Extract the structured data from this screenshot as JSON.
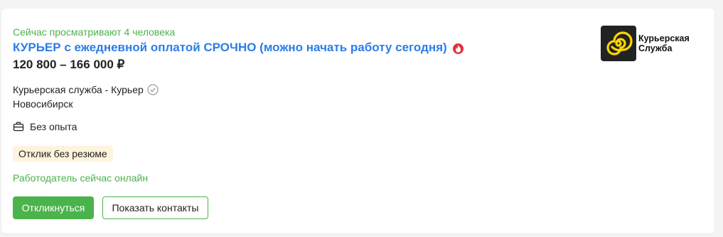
{
  "vacancy": {
    "viewers_text": "Сейчас просматривают 4 человека",
    "title": "КУРЬЕР с ежедневной оплатой СРОЧНО (можно начать работу сегодня)",
    "salary": "120 800 – 166 000 ₽",
    "company": "Курьерская служба - Курьер",
    "city": "Новосибирск",
    "experience": "Без опыта",
    "badge": "Отклик без резюме",
    "employer_status": "Работодатель сейчас онлайн"
  },
  "actions": {
    "respond_label": "Откликнуться",
    "contacts_label": "Показать контакты"
  },
  "logo": {
    "text_line1": "Курьерская",
    "text_line2": "Служба",
    "icon": "yellow-spiral-logo"
  },
  "icons": {
    "hot": "fire-icon",
    "verified": "check-circle-icon",
    "experience": "briefcase-icon"
  },
  "colors": {
    "accent_green": "#4bb34b",
    "title_blue": "#2b7de9",
    "hot_red": "#e4303c",
    "badge_bg": "#fef3dd",
    "logo_yellow": "#ffd600"
  }
}
